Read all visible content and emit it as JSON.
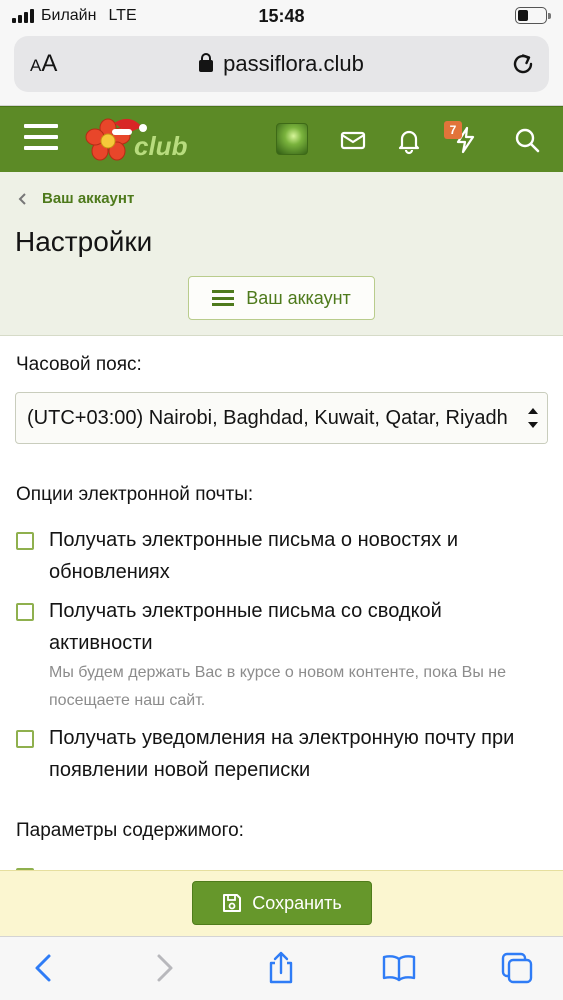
{
  "status_bar": {
    "carrier": "Билайн",
    "network": "LTE",
    "time": "15:48",
    "battery_level": 0.4
  },
  "browser": {
    "text_size_button": "AA",
    "url": "passiflora.club"
  },
  "header": {
    "logo_text": "club",
    "alerts_badge": "7",
    "accent_color": "#5c8a26"
  },
  "page": {
    "breadcrumb": "Ваш аккаунт",
    "title": "Настройки",
    "account_menu_label": "Ваш аккаунт"
  },
  "form": {
    "timezone_label": "Часовой пояс:",
    "timezone_value": "(UTC+03:00) Nairobi, Baghdad, Kuwait, Qatar, Riyadh",
    "email_options_label": "Опции электронной почты:",
    "email_options": [
      {
        "label": "Получать электронные письма о новостях и обновлениях",
        "checked": false
      },
      {
        "label": "Получать электронные письма со сводкой активности",
        "checked": false,
        "hint": "Мы будем держать Вас в курсе о новом контенте, пока Вы не посещаете наш сайт."
      },
      {
        "label": "Получать уведомления на электронную почту при появлении новой переписки",
        "checked": false
      }
    ],
    "content_options_label": "Параметры содержимого:"
  },
  "actions": {
    "save_label": "Сохранить"
  }
}
